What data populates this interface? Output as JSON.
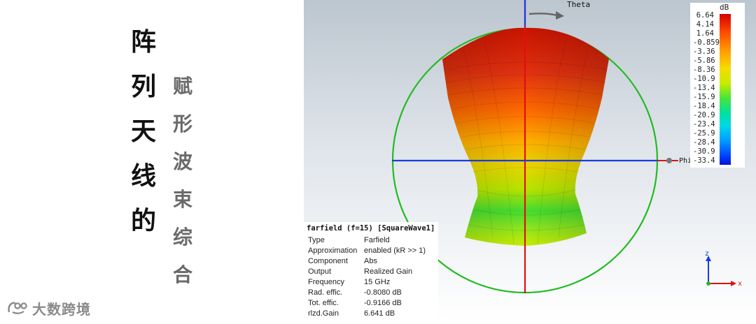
{
  "title": {
    "chars": [
      "阵",
      "列",
      "天",
      "线",
      "的"
    ]
  },
  "subtitle": {
    "chars": [
      "赋",
      "形",
      "波",
      "束",
      "综",
      "合"
    ]
  },
  "watermark": {
    "text": "大数跨境"
  },
  "viewport": {
    "axis_theta": "Theta",
    "axis_phi": "Phi",
    "axis_z": "z",
    "axis_x": "x"
  },
  "legend": {
    "unit": "dB",
    "ticks": [
      "6.64",
      "4.14",
      "1.64",
      "-0.859",
      "-3.36",
      "-5.86",
      "-8.36",
      "-10.9",
      "-13.4",
      "-15.9",
      "-18.4",
      "-20.9",
      "-23.4",
      "-25.9",
      "-28.4",
      "-30.9",
      "-33.4"
    ]
  },
  "info": {
    "header": "farfield (f=15) [SquareWave1]",
    "rows": [
      {
        "key": "Type",
        "value": "Farfield"
      },
      {
        "key": "Approximation",
        "value": "enabled (kR >> 1)"
      },
      {
        "key": "Component",
        "value": "Abs"
      },
      {
        "key": "Output",
        "value": "Realized Gain"
      },
      {
        "key": "Frequency",
        "value": "15 GHz"
      },
      {
        "key": "Rad. effic.",
        "value": "-0.8080 dB"
      },
      {
        "key": "Tot. effic.",
        "value": "-0.9166 dB"
      },
      {
        "key": "rlzd.Gain",
        "value": "6.641 dB"
      }
    ]
  },
  "colors": {
    "circle": "#22bb22",
    "theta_axis": "#1a3be0",
    "vertical_axis": "#e01010",
    "legend_top": "#d40000",
    "legend_bottom": "#0010d8"
  }
}
